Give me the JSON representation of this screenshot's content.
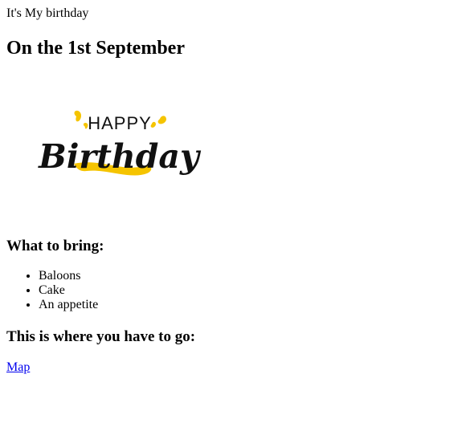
{
  "intro": {
    "text": "It's My birthday"
  },
  "main": {
    "title": "On the 1st September"
  },
  "banner": {
    "top_text": "HAPPY",
    "script_text": "Birthday",
    "text_color": "#111111",
    "accent_color": "#f5c400"
  },
  "bring": {
    "heading": "What to bring:",
    "items": [
      "Baloons",
      "Cake",
      "An appetite"
    ]
  },
  "route": {
    "heading": "This is where you have to go:",
    "link_label": "Map",
    "link_color": "#0000ee"
  }
}
